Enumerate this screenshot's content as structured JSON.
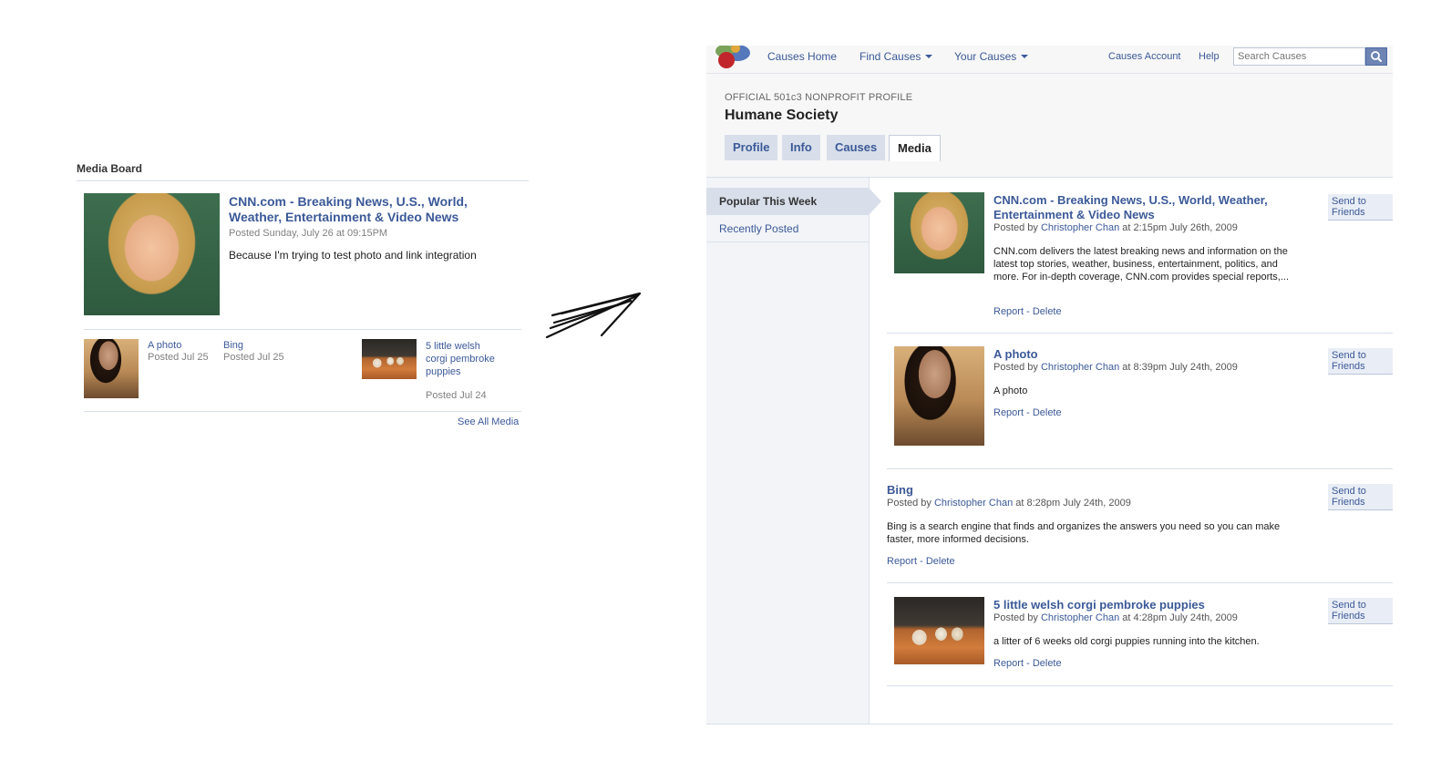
{
  "board": {
    "heading": "Media Board",
    "featured": {
      "title": "CNN.com - Breaking News, U.S., World, Weather, Entertainment & Video News",
      "posted": "Posted Sunday, July 26 at 09:15PM",
      "body": "Because I'm trying to test photo and link integration"
    },
    "items": [
      {
        "title": "A photo",
        "posted": "Posted Jul 25"
      },
      {
        "title": "Bing",
        "posted": "Posted Jul 25"
      },
      {
        "title": "5 little welsh corgi pembroke puppies",
        "posted": "Posted Jul 24"
      }
    ],
    "see_all": "See All Media"
  },
  "causes": {
    "nav": {
      "home": "Causes Home",
      "find": "Find Causes",
      "yours": "Your Causes",
      "account": "Causes Account",
      "help": "Help",
      "search_placeholder": "Search Causes"
    },
    "subtitle": "OFFICIAL 501c3 NONPROFIT PROFILE",
    "org_name": "Humane Society",
    "tabs": [
      "Profile",
      "Info",
      "Causes",
      "Media"
    ],
    "active_tab": "Media",
    "sidebar": {
      "popular": "Popular This Week",
      "recent": "Recently Posted"
    },
    "send_label": "Send to Friends",
    "report_label": "Report",
    "delete_label": "Delete",
    "sep": " - ",
    "posted_by_prefix": "Posted by",
    "media": [
      {
        "title": "CNN.com - Breaking News, U.S., World, Weather, Entertainment & Video News",
        "author": "Christopher Chan",
        "when": "at 2:15pm July 26th, 2009",
        "desc": "CNN.com delivers the latest breaking news and information on the latest top stories, weather, business, entertainment, politics, and more. For in-depth coverage, CNN.com provides special reports,..."
      },
      {
        "title": "A photo",
        "author": "Christopher Chan",
        "when": "at 8:39pm July 24th, 2009",
        "desc": "A photo"
      },
      {
        "title": "Bing",
        "author": "Christopher Chan",
        "when": "at 8:28pm July 24th, 2009",
        "desc": "Bing is a search engine that finds and organizes the answers you need so you can make faster, more informed decisions."
      },
      {
        "title": "5 little welsh corgi pembroke puppies",
        "author": "Christopher Chan",
        "when": "at 4:28pm July 24th, 2009",
        "desc": "a litter of 6 weeks old corgi puppies running into the kitchen."
      }
    ]
  },
  "icons": [
    "causes-logo-icon",
    "search-icon",
    "chevron-down-icon",
    "hand-drawn-arrow-icon"
  ],
  "colors": {
    "link": "#3b5998",
    "tab_bg": "#d8dfea",
    "search_btn": "#6d84b4"
  }
}
